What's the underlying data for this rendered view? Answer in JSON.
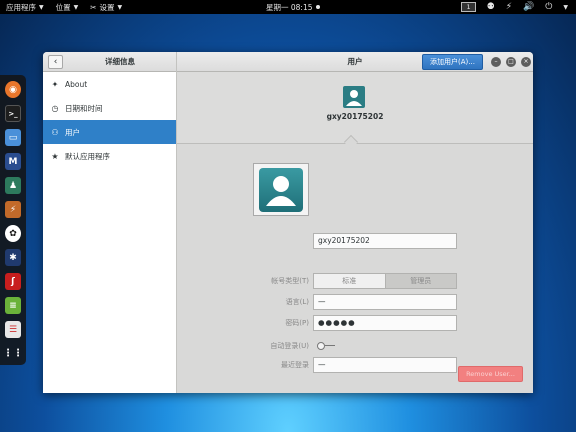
{
  "topbar": {
    "apps_menu": "应用程序",
    "places_menu": "位置",
    "settings_menu": "设置",
    "clock": "星期一 08:15",
    "workspace": "1"
  },
  "window": {
    "left_title": "详细信息",
    "main_title": "用户",
    "add_user_label": "添加用户(A)..."
  },
  "sidebar": {
    "items": [
      {
        "label": "About",
        "icon": "star-icon"
      },
      {
        "label": "日期和时间",
        "icon": "clock-icon"
      },
      {
        "label": "用户",
        "icon": "users-icon"
      },
      {
        "label": "默认应用程序",
        "icon": "star-icon"
      }
    ]
  },
  "user": {
    "strip_name": "gxy20175202",
    "username_value": "gxy20175202",
    "account_type_label": "帐号类型(T)",
    "account_type_standard": "标准",
    "account_type_admin": "管理员",
    "language_label": "语言(L)",
    "language_value": "—",
    "password_label": "密码(P)",
    "password_value": "●●●●●",
    "autologin_label": "自动登录(U)",
    "last_login_label": "最近登录",
    "last_login_value": "—",
    "remove_label": "Remove User..."
  },
  "colors": {
    "accent": "#2f80c8",
    "remove": "#f28080",
    "avatar": "#2b7d84"
  }
}
